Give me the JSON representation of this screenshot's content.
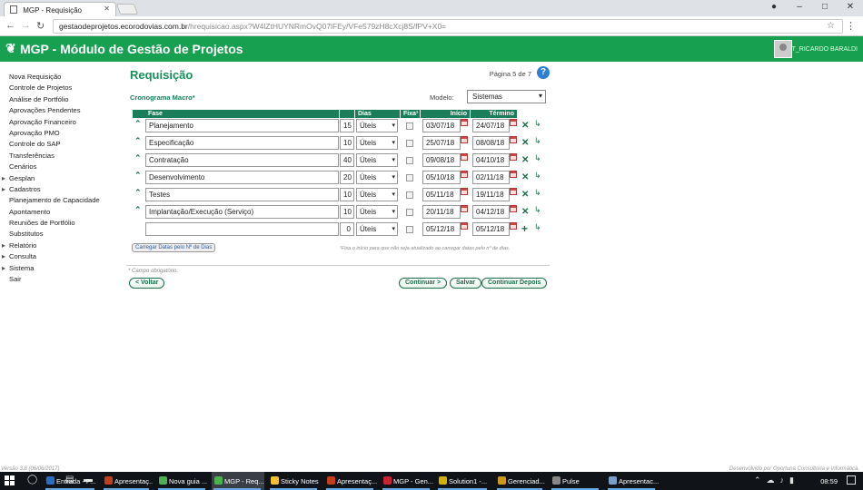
{
  "browser": {
    "tab_title": "MGP - Requisição",
    "url_host": "gestaodeprojetos.ecorodovias.com.br",
    "url_path": "/hrequisicao.aspx?W4lZtHUYNRmOvQ07lFEy/VFe579zH8cXcj8S/fPV+X0="
  },
  "app": {
    "title": "MGP - Módulo de Gestão de Projetos",
    "user": "T_RICARDO BARALDI",
    "brand_color": "#16a050"
  },
  "sidebar": {
    "items": [
      {
        "label": "Nova Requisição"
      },
      {
        "label": "Controle de Projetos"
      },
      {
        "label": "Análise de Portfólio"
      },
      {
        "label": "Aprovações Pendentes"
      },
      {
        "label": "Aprovação Financeiro"
      },
      {
        "label": "Aprovação PMO"
      },
      {
        "label": "Controle do SAP"
      },
      {
        "label": "Transferências"
      },
      {
        "label": "Cenários"
      },
      {
        "label": "Gesplan"
      },
      {
        "label": "Cadastros"
      },
      {
        "label": "Planejamento de Capacidade"
      },
      {
        "label": "Apontamento"
      },
      {
        "label": "Reuniões de Portfólio"
      },
      {
        "label": "Substitutos"
      },
      {
        "label": "Relatório"
      },
      {
        "label": "Consulta"
      },
      {
        "label": "Sistema"
      },
      {
        "label": "Sair"
      }
    ]
  },
  "main": {
    "heading": "Requisição",
    "page_info": "Página 5 de 7",
    "help_label": "?",
    "cronograma_label": "Cronograma Macro*",
    "modelo_label": "Modelo:",
    "modelo_value": "Sistemas",
    "table": {
      "headers": {
        "fase": "Fase",
        "dias": "Dias",
        "fixa": "Fixa¹",
        "inicio": "Início",
        "termino": "Término"
      },
      "rows": [
        {
          "fase": "Planejamento",
          "dias": "15",
          "tipo": "Úteis",
          "inicio": "03/07/18",
          "termino": "24/07/18"
        },
        {
          "fase": "Especificação",
          "dias": "10",
          "tipo": "Úteis",
          "inicio": "25/07/18",
          "termino": "08/08/18"
        },
        {
          "fase": "Contratação",
          "dias": "40",
          "tipo": "Úteis",
          "inicio": "09/08/18",
          "termino": "04/10/18"
        },
        {
          "fase": "Desenvolvimento",
          "dias": "20",
          "tipo": "Úteis",
          "inicio": "05/10/18",
          "termino": "02/11/18"
        },
        {
          "fase": "Testes",
          "dias": "10",
          "tipo": "Úteis",
          "inicio": "05/11/18",
          "termino": "19/11/18"
        },
        {
          "fase": "Implantação/Execução (Serviço)",
          "dias": "10",
          "tipo": "Úteis",
          "inicio": "20/11/18",
          "termino": "04/12/18"
        }
      ],
      "new_row": {
        "fase": "",
        "dias": "0",
        "tipo": "Úteis",
        "inicio": "05/12/18",
        "termino": "05/12/18"
      }
    },
    "carregar_button": "Carregar Datas pelo Nº de Dias",
    "fixa_note": "¹Fixa o início para que não seja atualizado ao carregar datas pelo nº de dias.",
    "obrigatorio_note": "* Campo obrigatório.",
    "buttons": {
      "voltar": "< Voltar",
      "continuar": "Continuar >",
      "salvar": "Salvar",
      "continuar_depois": "Continuar Depois"
    }
  },
  "footer": {
    "version": "Versão 3.8 (06/06/2017)",
    "credit": "Desenvolvido por Oportuna Consultoria e Informática."
  },
  "taskbar": {
    "items": [
      {
        "label": "Entrada - P...",
        "color": "#2b6cc4"
      },
      {
        "label": "Apresentaç...",
        "color": "#c43e1c"
      },
      {
        "label": "Nova guia ...",
        "color": "#4caf50"
      },
      {
        "label": "MGP - Req...",
        "color": "#4caf50"
      },
      {
        "label": "Sticky Notes",
        "color": "#f2c230"
      },
      {
        "label": "Apresentaç...",
        "color": "#c43e1c"
      },
      {
        "label": "MGP - Gen...",
        "color": "#c23"
      },
      {
        "label": "Solution1 -...",
        "color": "#d4b000"
      },
      {
        "label": "Gerenciad...",
        "color": "#cc9a1a"
      },
      {
        "label": "Pulse",
        "color": "#888"
      },
      {
        "label": "Apresentac...",
        "color": "#7a9ec8"
      }
    ],
    "time": "08:59"
  }
}
